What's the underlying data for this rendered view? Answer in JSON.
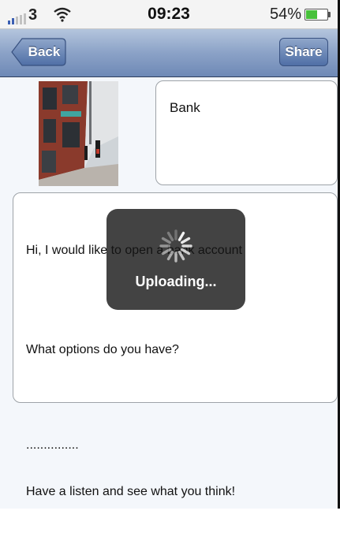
{
  "status_bar": {
    "carrier": "3",
    "time": "09:23",
    "battery_level": "54%",
    "battery_fraction": 0.54,
    "signal_bars_on": 2,
    "battery_color": "#47c13a"
  },
  "nav": {
    "back_label": "Back",
    "share_label": "Share"
  },
  "note": {
    "title": "Bank",
    "lines": [
      "Hi, I would like to open a bank account",
      "",
      "What options do you have?",
      "",
      "...............",
      "Have a listen and see what you think!"
    ]
  },
  "hud": {
    "label": "Uploading..."
  },
  "icons": {
    "signal": "signal-bars-icon",
    "wifi": "wifi-icon",
    "battery": "battery-icon",
    "spinner": "activity-spinner-icon"
  }
}
